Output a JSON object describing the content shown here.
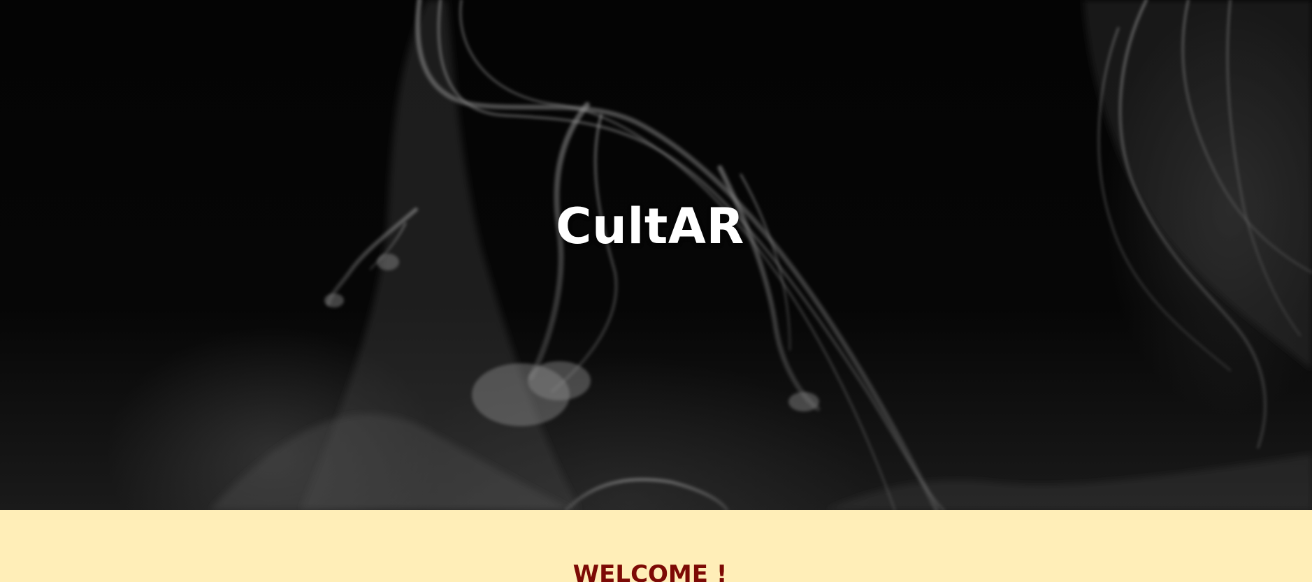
{
  "hero": {
    "title": "CultAR",
    "background_image": "dark-smoke-photo"
  },
  "welcome": {
    "title": "WELCOME !"
  },
  "colors": {
    "hero_background": "#000000",
    "hero_title": "#ffffff",
    "welcome_band": "#ffeeb8",
    "welcome_title": "#7d0a05"
  }
}
